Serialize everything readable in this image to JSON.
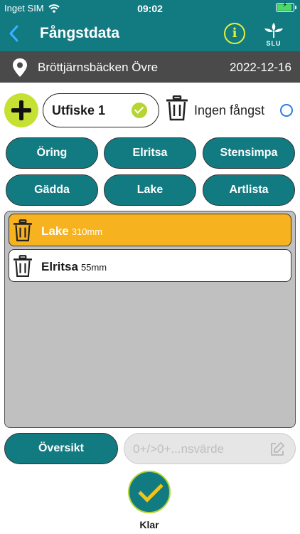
{
  "status_bar": {
    "carrier": "Inget SIM",
    "time": "09:02"
  },
  "nav": {
    "title": "Fångstdata",
    "logo_text": "SLU"
  },
  "location": {
    "name": "Bröttjärnsbäcken Övre",
    "date": "2022-12-16"
  },
  "controls": {
    "utfiske_label": "Utfiske 1",
    "ingen_fangst_label": "Ingen fångst"
  },
  "species_buttons": [
    "Öring",
    "Elritsa",
    "Stensimpa",
    "Gädda",
    "Lake",
    "Artlista"
  ],
  "catch_list": [
    {
      "name": "Lake",
      "size": "310mm",
      "selected": true
    },
    {
      "name": "Elritsa",
      "size": "55mm",
      "selected": false
    }
  ],
  "bottom": {
    "oversikt_label": "Översikt",
    "value_placeholder": "0+/>0+...nsvärde",
    "klar_label": "Klar"
  },
  "colors": {
    "primary": "#127b82",
    "accent": "#c6e033",
    "selected_row": "#f7b21f",
    "location_bar": "#4a4a4a",
    "list_bg": "#c0c0c0"
  }
}
